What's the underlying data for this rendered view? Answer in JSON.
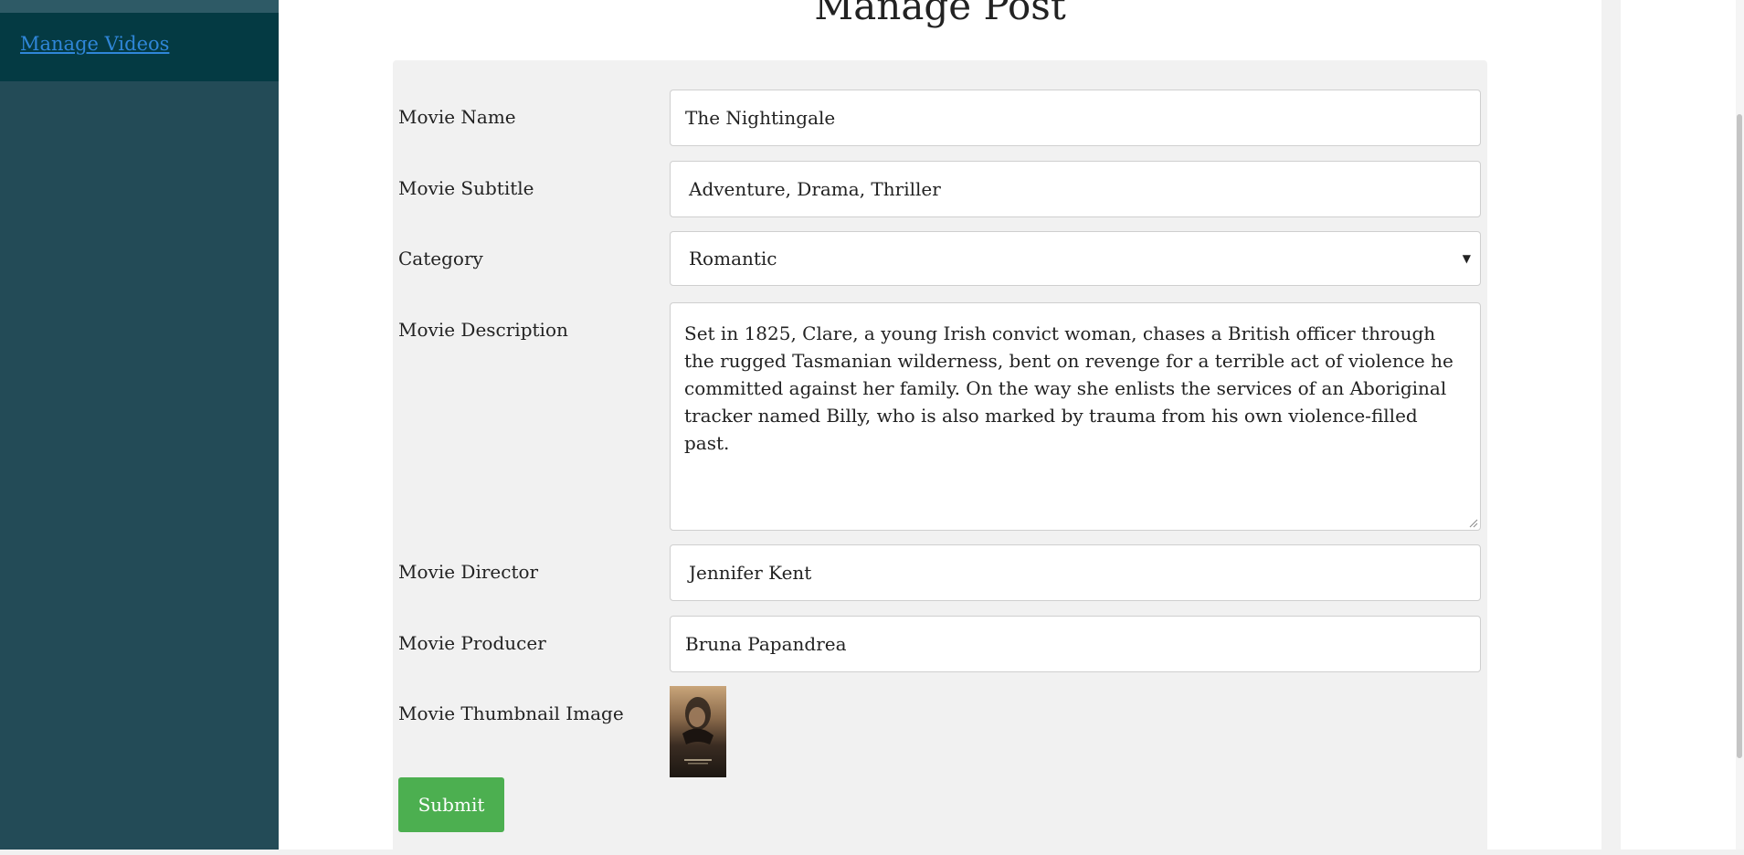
{
  "sidebar": {
    "items": [
      {
        "label": "Manage Videos"
      }
    ]
  },
  "page": {
    "title": "Manage Post"
  },
  "form": {
    "movie_name": {
      "label": "Movie Name",
      "value": "The Nightingale"
    },
    "movie_subtitle": {
      "label": "Movie Subtitle",
      "value": "Adventure, Drama, Thriller"
    },
    "category": {
      "label": "Category",
      "value": "Romantic"
    },
    "movie_description": {
      "label": "Movie Description",
      "value": "Set in 1825, Clare, a young Irish convict woman, chases a British officer through the rugged Tasmanian wilderness, bent on revenge for a terrible act of violence he committed against her family. On the way she enlists the services of an Aboriginal tracker named Billy, who is also marked by trauma from his own violence-filled past."
    },
    "movie_director": {
      "label": "Movie Director",
      "value": "Jennifer Kent"
    },
    "movie_producer": {
      "label": "Movie Producer",
      "value": "Bruna Papandrea"
    },
    "movie_thumbnail": {
      "label": "Movie Thumbnail Image"
    },
    "submit_label": "Submit"
  },
  "colors": {
    "sidebar_bg": "#234b57",
    "sidebar_active_bg": "#043a43",
    "link": "#2f86d8",
    "submit_bg": "#4caf50",
    "panel_bg": "#f1f1f1"
  },
  "icons": {
    "select_arrow": "caret-down-icon",
    "textarea_resize": "resize-grip-icon"
  }
}
